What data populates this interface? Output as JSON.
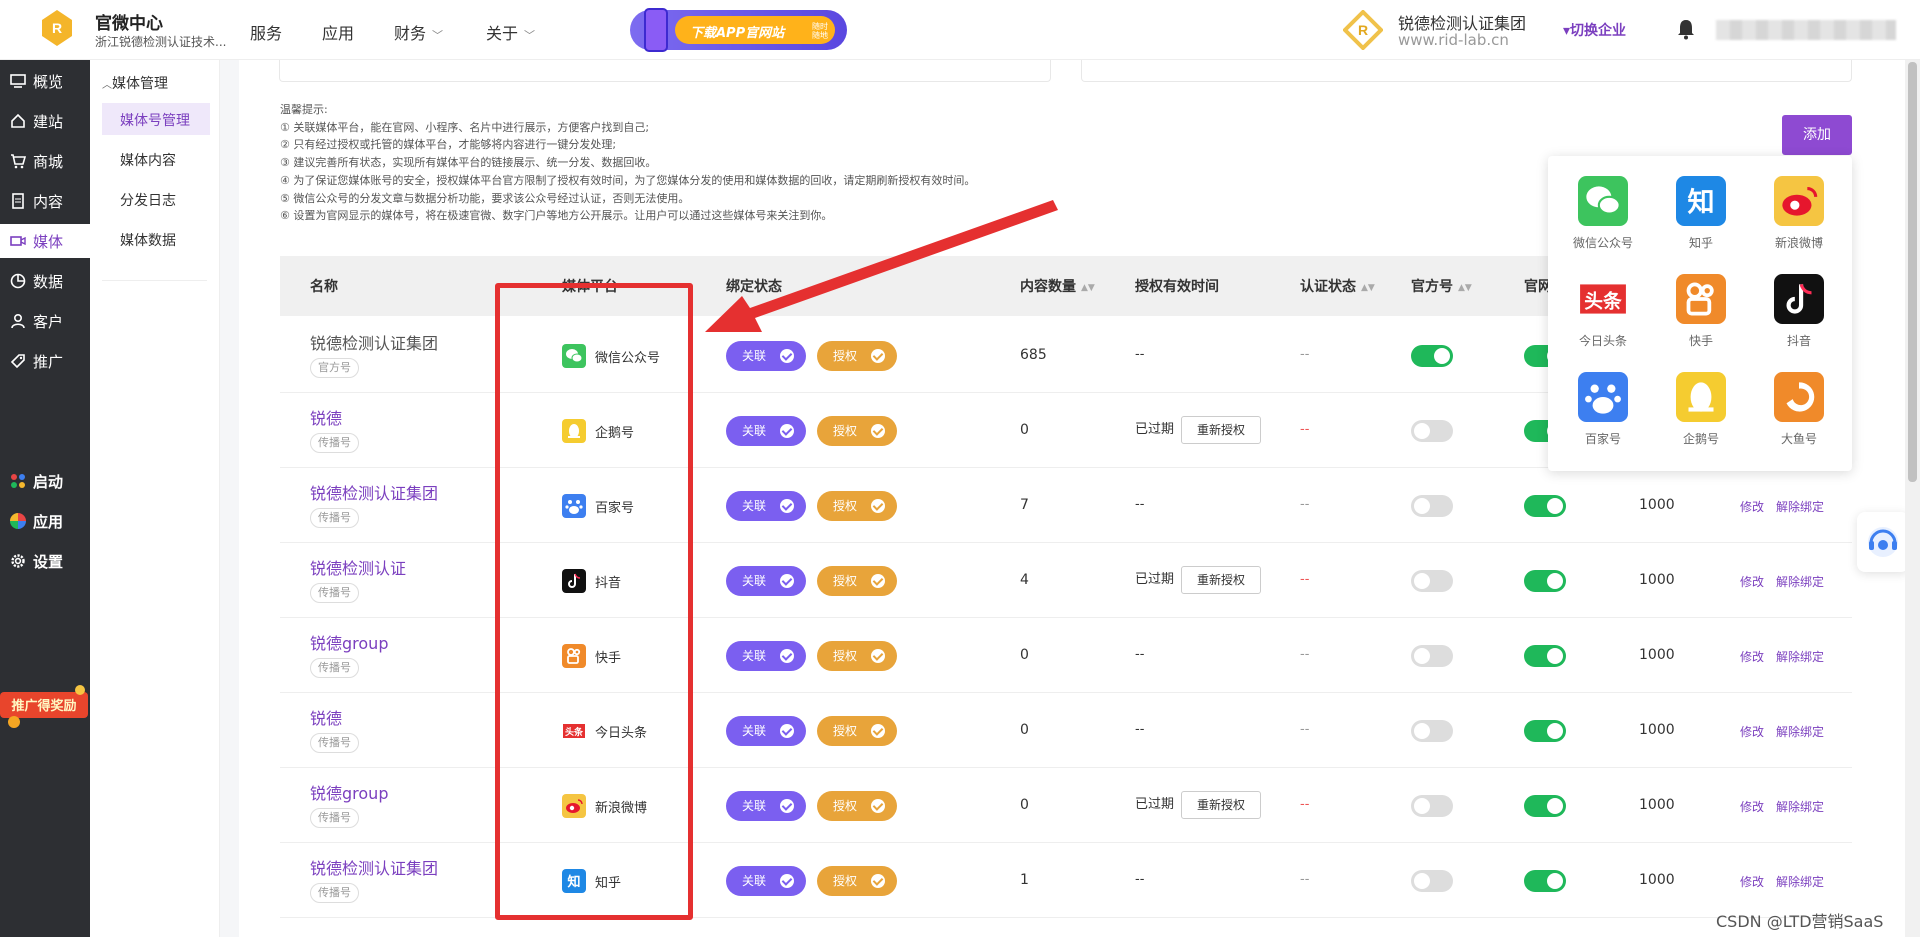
{
  "header": {
    "brand_title": "官微中心",
    "brand_sub": "浙江锐德检测认证技术...",
    "nav": [
      {
        "label": "服务",
        "dropdown": false
      },
      {
        "label": "应用",
        "dropdown": false
      },
      {
        "label": "财务",
        "dropdown": true
      },
      {
        "label": "关于",
        "dropdown": true
      }
    ],
    "promo_text": "下载APP官网站",
    "promo_small": "随时随地",
    "corp_name": "锐德检测认证集团",
    "corp_url": "www.rid-lab.cn",
    "switch_label": "▾切换企业",
    "bell_icon": "bell-icon"
  },
  "sidebar": {
    "items": [
      {
        "label": "概览",
        "icon": "dashboard-icon"
      },
      {
        "label": "建站",
        "icon": "home-icon"
      },
      {
        "label": "商城",
        "icon": "cart-icon"
      },
      {
        "label": "内容",
        "icon": "document-icon"
      },
      {
        "label": "媒体",
        "icon": "media-icon",
        "active": true
      },
      {
        "label": "数据",
        "icon": "chart-icon"
      },
      {
        "label": "客户",
        "icon": "user-icon"
      },
      {
        "label": "推广",
        "icon": "tag-icon"
      }
    ],
    "bottom_items": [
      {
        "label": "启动",
        "icon": "launch-icon"
      },
      {
        "label": "应用",
        "icon": "apps-icon"
      },
      {
        "label": "设置",
        "icon": "gear-icon"
      }
    ],
    "reward_text": "推广得奖励"
  },
  "subsidebar": {
    "heading": "媒体管理",
    "items": [
      {
        "label": "媒体号管理",
        "active": true
      },
      {
        "label": "媒体内容"
      },
      {
        "label": "分发日志"
      },
      {
        "label": "媒体数据"
      }
    ]
  },
  "tips": [
    "温馨提示:",
    "① 关联媒体平台，能在官网、小程序、名片中进行展示，方便客户找到自己;",
    "② 只有经过授权或托管的媒体平台，才能够将内容进行一键分发处理;",
    "③ 建议完善所有状态，实现所有媒体平台的链接展示、统一分发、数据回收。",
    "④ 为了保证您媒体账号的安全，授权媒体平台官方限制了授权有效时间，为了您媒体分发的使用和媒体数据的回收，请定期刷新授权有效时间。",
    "⑤ 微信公众号的分发文章与数据分析功能，要求该公众号经过认证，否则无法使用。",
    "⑥ 设置为官网显示的媒体号，将在极速官微、数字门户等地方公开展示。让用户可以通过这些媒体号来关注到你。"
  ],
  "add_label": "添加",
  "table": {
    "headers": {
      "name": "名称",
      "platform": "媒体平台",
      "bind": "绑定状态",
      "count": "内容数量",
      "valid": "授权有效时间",
      "cert": "认证状态",
      "official": "官方号",
      "official2": "官网"
    },
    "link_label": "关联",
    "auth_label": "授权",
    "reauth_label": "重新授权",
    "edit_label": "修改",
    "unbind_label": "解除绑定",
    "rows": [
      {
        "name": "锐德检测认证集团",
        "tag": "官方号",
        "platform": "微信公众号",
        "icon": "wechat-icon",
        "count": "685",
        "valid": "--",
        "expired": false,
        "cert": "--",
        "cert_red": false,
        "official": true,
        "site": true,
        "limit": ""
      },
      {
        "name": "锐德",
        "tag": "传播号",
        "platform": "企鹅号",
        "icon": "penguin-icon",
        "count": "0",
        "valid": "已过期",
        "expired": true,
        "cert": "--",
        "cert_red": true,
        "official": false,
        "site": true,
        "limit": ""
      },
      {
        "name": "锐德检测认证集团",
        "tag": "传播号",
        "platform": "百家号",
        "icon": "baijia-icon",
        "count": "7",
        "valid": "--",
        "expired": false,
        "cert": "--",
        "cert_red": false,
        "official": false,
        "site": true,
        "limit": "1000"
      },
      {
        "name": "锐德检测认证",
        "tag": "传播号",
        "platform": "抖音",
        "icon": "douyin-icon",
        "count": "4",
        "valid": "已过期",
        "expired": true,
        "cert": "--",
        "cert_red": true,
        "official": false,
        "site": true,
        "limit": "1000"
      },
      {
        "name": "锐德group",
        "tag": "传播号",
        "platform": "快手",
        "icon": "kuaishou-icon",
        "count": "0",
        "valid": "--",
        "expired": false,
        "cert": "--",
        "cert_red": false,
        "official": false,
        "site": true,
        "limit": "1000"
      },
      {
        "name": "锐德",
        "tag": "传播号",
        "platform": "今日头条",
        "icon": "toutiao-icon",
        "count": "0",
        "valid": "--",
        "expired": false,
        "cert": "--",
        "cert_red": false,
        "official": false,
        "site": true,
        "limit": "1000"
      },
      {
        "name": "锐德group",
        "tag": "传播号",
        "platform": "新浪微博",
        "icon": "weibo-icon",
        "count": "0",
        "valid": "已过期",
        "expired": true,
        "cert": "--",
        "cert_red": true,
        "official": false,
        "site": true,
        "limit": "1000"
      },
      {
        "name": "锐德检测认证集团",
        "tag": "传播号",
        "platform": "知乎",
        "icon": "zhihu-icon",
        "count": "1",
        "valid": "--",
        "expired": false,
        "cert": "--",
        "cert_red": false,
        "official": false,
        "site": true,
        "limit": "1000"
      }
    ]
  },
  "popup": {
    "items": [
      {
        "label": "微信公众号",
        "icon": "wechat-icon",
        "color": "#3dc45e"
      },
      {
        "label": "知乎",
        "icon": "zhihu-icon",
        "color": "#1e88e5"
      },
      {
        "label": "新浪微博",
        "icon": "weibo-icon",
        "color": "#f5c542"
      },
      {
        "label": "今日头条",
        "icon": "toutiao-icon",
        "color": "#ffffff"
      },
      {
        "label": "快手",
        "icon": "kuaishou-icon",
        "color": "#f08a2a"
      },
      {
        "label": "抖音",
        "icon": "douyin-icon",
        "color": "#111111"
      },
      {
        "label": "百家号",
        "icon": "baijia-icon",
        "color": "#3d7ff0"
      },
      {
        "label": "企鹅号",
        "icon": "penguin-icon",
        "color": "#f5cc30"
      },
      {
        "label": "大鱼号",
        "icon": "dayu-icon",
        "color": "#f08a2a"
      }
    ]
  },
  "watermark": "CSDN @LTD营销SaaS",
  "colors": {
    "accent": "#7b3fbf",
    "link_btn": "#7b5ff0",
    "auth_btn": "#e8a43a",
    "toggle_on": "#1fb85a",
    "highlight": "#e53030"
  }
}
